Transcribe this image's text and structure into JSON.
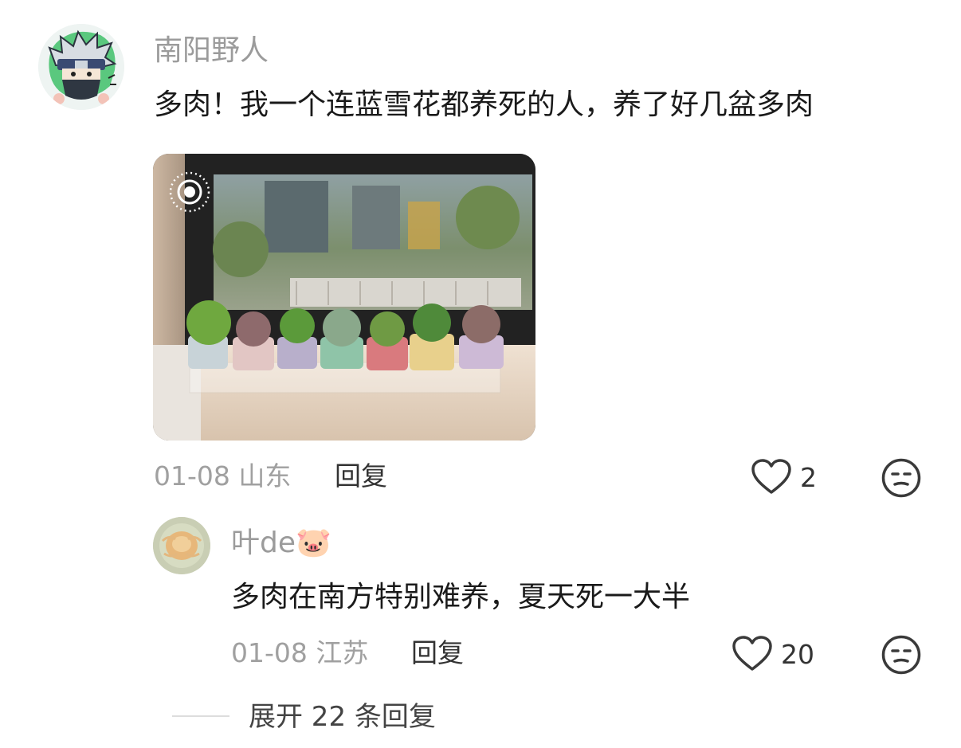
{
  "comment": {
    "username": "南阳野人",
    "text": "多肉！我一个连蓝雪花都养死的人，养了好几盆多肉",
    "date": "01-08",
    "location": "山东",
    "reply_label": "回复",
    "like_count": "2",
    "like_icon": "heart-outline-icon",
    "dislike_icon": "meh-face-icon"
  },
  "reply": {
    "username": "叶de",
    "username_emoji": "🐷",
    "text": "多肉在南方特别难养，夏天死一大半",
    "date": "01-08",
    "location": "江苏",
    "reply_label": "回复",
    "like_count": "20",
    "like_icon": "heart-outline-icon",
    "dislike_icon": "meh-face-icon"
  },
  "expand": {
    "label": "展开 22 条回复"
  },
  "colors": {
    "username": "#9b9b9b",
    "meta": "#a0a0a0",
    "text": "#1a1a1a",
    "icon": "#3a3a3a"
  }
}
